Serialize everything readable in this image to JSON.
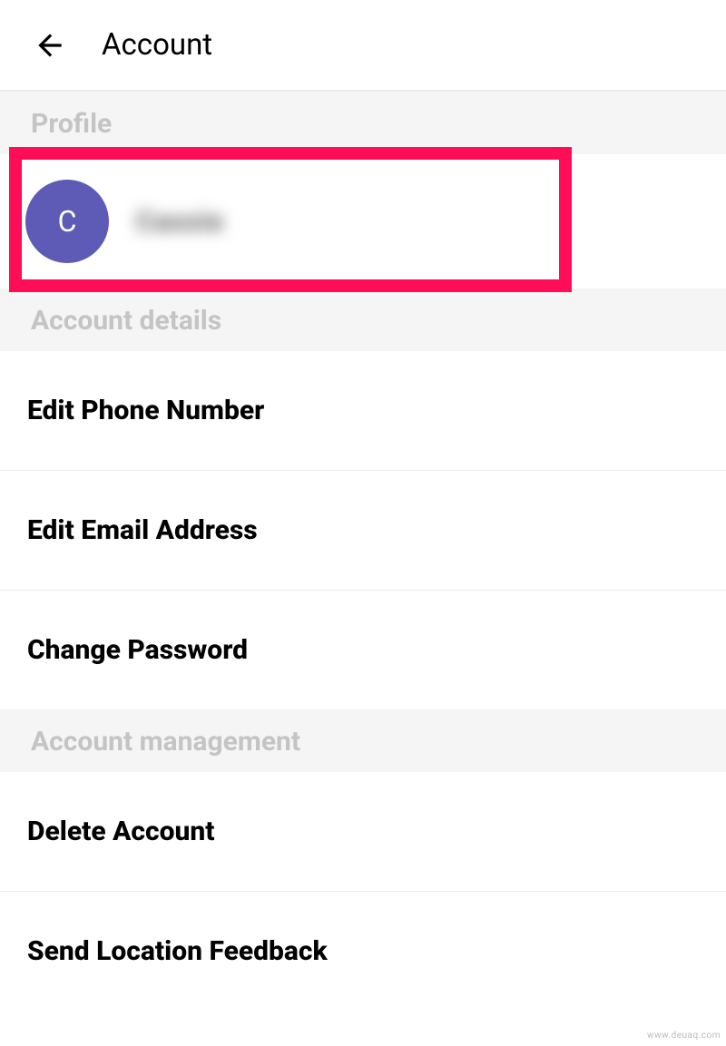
{
  "header": {
    "title": "Account"
  },
  "sections": {
    "profile": {
      "label": "Profile",
      "avatar_initial": "C",
      "user_name": "Cassie"
    },
    "account_details": {
      "label": "Account details",
      "items": [
        {
          "label": "Edit Phone Number"
        },
        {
          "label": "Edit Email Address"
        },
        {
          "label": "Change Password"
        }
      ]
    },
    "account_management": {
      "label": "Account management",
      "items": [
        {
          "label": "Delete Account"
        },
        {
          "label": "Send Location Feedback"
        }
      ]
    }
  },
  "watermark": "www.deuaq.com"
}
